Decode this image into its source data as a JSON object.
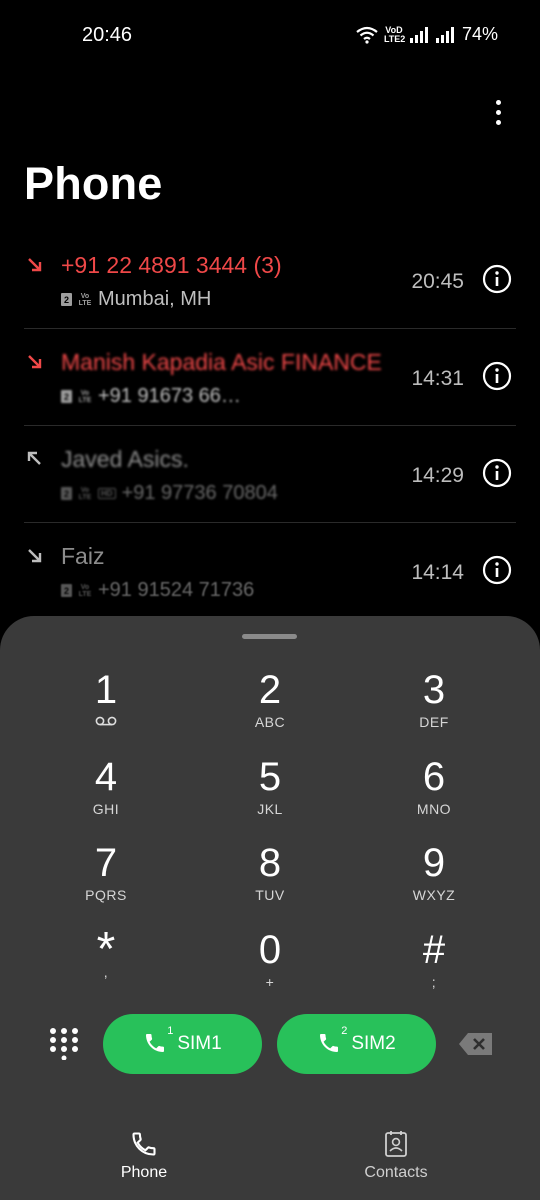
{
  "status": {
    "time": "20:46",
    "battery": "74%",
    "volte": "VoD LTE2"
  },
  "header": {
    "title": "Phone",
    "menu_icon": "more-vert-icon"
  },
  "calls": [
    {
      "name": "+91 22 4891 3444 (3)",
      "sub": "Mumbai, MH",
      "sim": "2",
      "hd": false,
      "time": "20:45",
      "type": "missed",
      "color": "#ef4848"
    },
    {
      "name": "Manish Kapadia Asic FINANCE",
      "sub": "+91 91673 66…",
      "sim": "2",
      "hd": false,
      "time": "14:31",
      "type": "missed",
      "color": "#ef4848"
    },
    {
      "name": "Javed Asics.",
      "sub": "+91 97736 70804",
      "sim": "2",
      "hd": true,
      "time": "14:29",
      "type": "outgoing",
      "color": "#ffffff"
    },
    {
      "name": "Faiz",
      "sub": "+91 91524 71736",
      "sim": "2",
      "hd": false,
      "time": "14:14",
      "type": "incoming",
      "color": "#ffffff"
    }
  ],
  "keypad": [
    {
      "digit": "1",
      "letters": ""
    },
    {
      "digit": "2",
      "letters": "ABC"
    },
    {
      "digit": "3",
      "letters": "DEF"
    },
    {
      "digit": "4",
      "letters": "GHI"
    },
    {
      "digit": "5",
      "letters": "JKL"
    },
    {
      "digit": "6",
      "letters": "MNO"
    },
    {
      "digit": "7",
      "letters": "PQRS"
    },
    {
      "digit": "8",
      "letters": "TUV"
    },
    {
      "digit": "9",
      "letters": "WXYZ"
    },
    {
      "digit": "*",
      "letters": ","
    },
    {
      "digit": "0",
      "letters": "+"
    },
    {
      "digit": "#",
      "letters": ";"
    }
  ],
  "actions": {
    "sim1_label": "SIM1",
    "sim1_sup": "1",
    "sim2_label": "SIM2",
    "sim2_sup": "2",
    "call_color": "#28c15a"
  },
  "nav": {
    "phone_label": "Phone",
    "contacts_label": "Contacts"
  }
}
